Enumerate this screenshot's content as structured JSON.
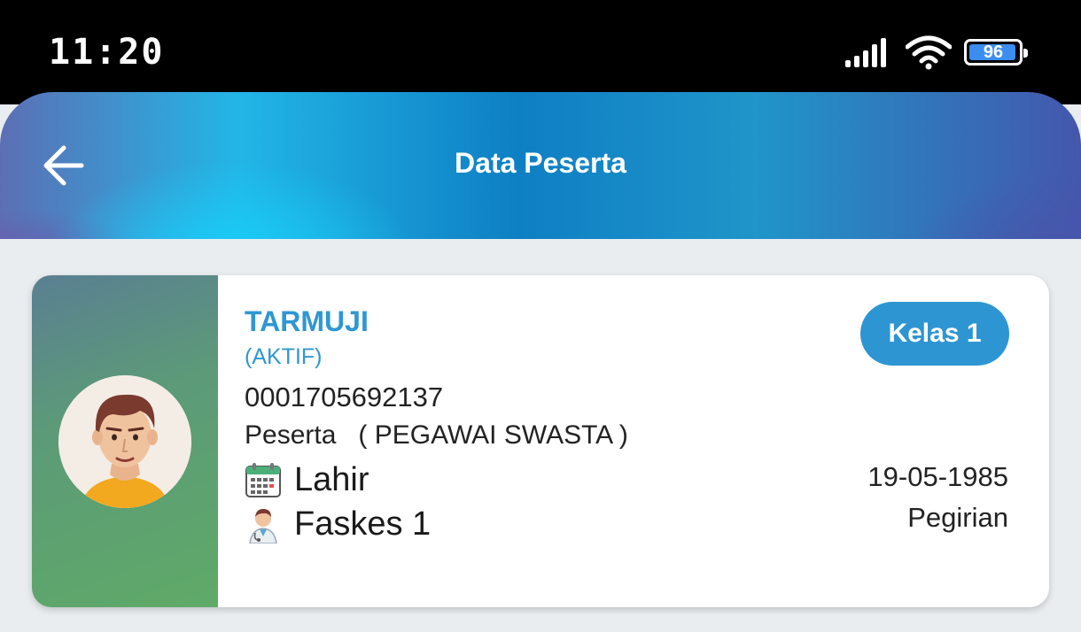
{
  "status_bar": {
    "time": "11:20",
    "battery_level": "96"
  },
  "header": {
    "title": "Data Peserta",
    "back_icon": "arrow-left-icon"
  },
  "participant": {
    "name": "TARMUJI",
    "status": "(AKTIF)",
    "card_number": "0001705692137",
    "type_line": "Peserta   ( PEGAWAI SWASTA )",
    "class_badge": "Kelas 1",
    "birth_label": "Lahir",
    "birth_date": "19-05-1985",
    "faskes_label": "Faskes 1",
    "faskes_value": "Pegirian"
  },
  "colors": {
    "accent": "#2e95d3",
    "card_side": "#5faa68"
  }
}
